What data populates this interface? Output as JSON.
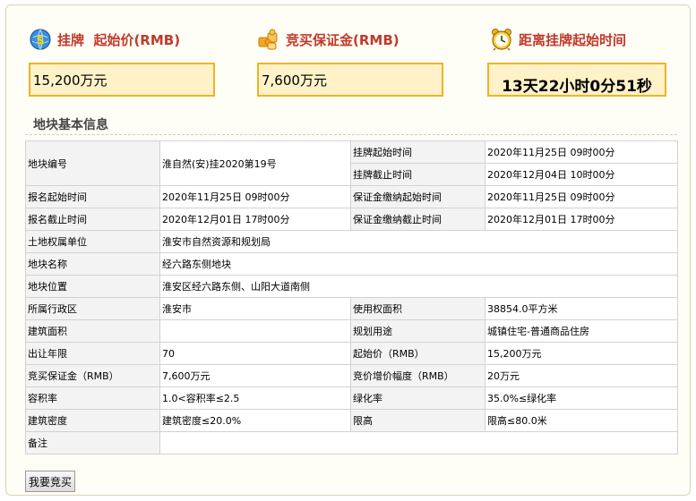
{
  "header": {
    "price_title": "挂牌  起始价(RMB)",
    "deposit_title": "竞买保证金(RMB)",
    "countdown_title": "距离挂牌起始时间",
    "price_value": "15,200万元",
    "deposit_value": "7,600万元",
    "countdown_value": "13天22小时0分51秒"
  },
  "section": {
    "title": "地块基本信息"
  },
  "table": {
    "r1": {
      "l1": "地块编号",
      "v1": "淮自然(安)挂2020第19号",
      "l2": "挂牌起始时间",
      "v2": "2020年11月25日 09时00分"
    },
    "r2": {
      "l2": "挂牌截止时间",
      "v2": "2020年12月04日 10时00分"
    },
    "r3": {
      "l1": "报名起始时间",
      "v1": "2020年11月25日 09时00分",
      "l2": "保证金缴纳起始时间",
      "v2": "2020年11月25日 09时00分"
    },
    "r4": {
      "l1": "报名截止时间",
      "v1": "2020年12月01日 17时00分",
      "l2": "保证金缴纳截止时间",
      "v2": "2020年12月01日 17时00分"
    },
    "r5": {
      "l1": "土地权属单位",
      "v1": "淮安市自然资源和规划局"
    },
    "r6": {
      "l1": "地块名称",
      "v1": "经六路东侧地块"
    },
    "r7": {
      "l1": "地块位置",
      "v1": "淮安区经六路东侧、山阳大道南侧"
    },
    "r8": {
      "l1": "所属行政区",
      "v1": "淮安市",
      "l2": "使用权面积",
      "v2": "38854.0平方米"
    },
    "r9": {
      "l1": "建筑面积",
      "v1": "",
      "l2": "规划用途",
      "v2": "城镇住宅-普通商品住房"
    },
    "r10": {
      "l1": "出让年限",
      "v1": "70",
      "l2": "起始价（RMB）",
      "v2": "15,200万元"
    },
    "r11": {
      "l1": "竞买保证金（RMB）",
      "v1": "7,600万元",
      "l2": "竞价增价幅度（RMB）",
      "v2": "20万元"
    },
    "r12": {
      "l1": "容积率",
      "v1": "1.0<容积率≤2.5",
      "l2": "绿化率",
      "v2": "35.0%≤绿化率"
    },
    "r13": {
      "l1": "建筑密度",
      "v1": "建筑密度≤20.0%",
      "l2": "限高",
      "v2": "限高≤80.0米"
    },
    "r14": {
      "l1": "备注",
      "v1": ""
    }
  },
  "buttons": {
    "bid": "我要竞买"
  },
  "icons": {
    "price": "money-globe-icon",
    "deposit": "puzzle-pieces-icon",
    "countdown": "alarm-clock-icon"
  },
  "colors": {
    "title_red": "#c0392b",
    "box_border": "#f0b323",
    "box_fill": "#fff2c8"
  }
}
